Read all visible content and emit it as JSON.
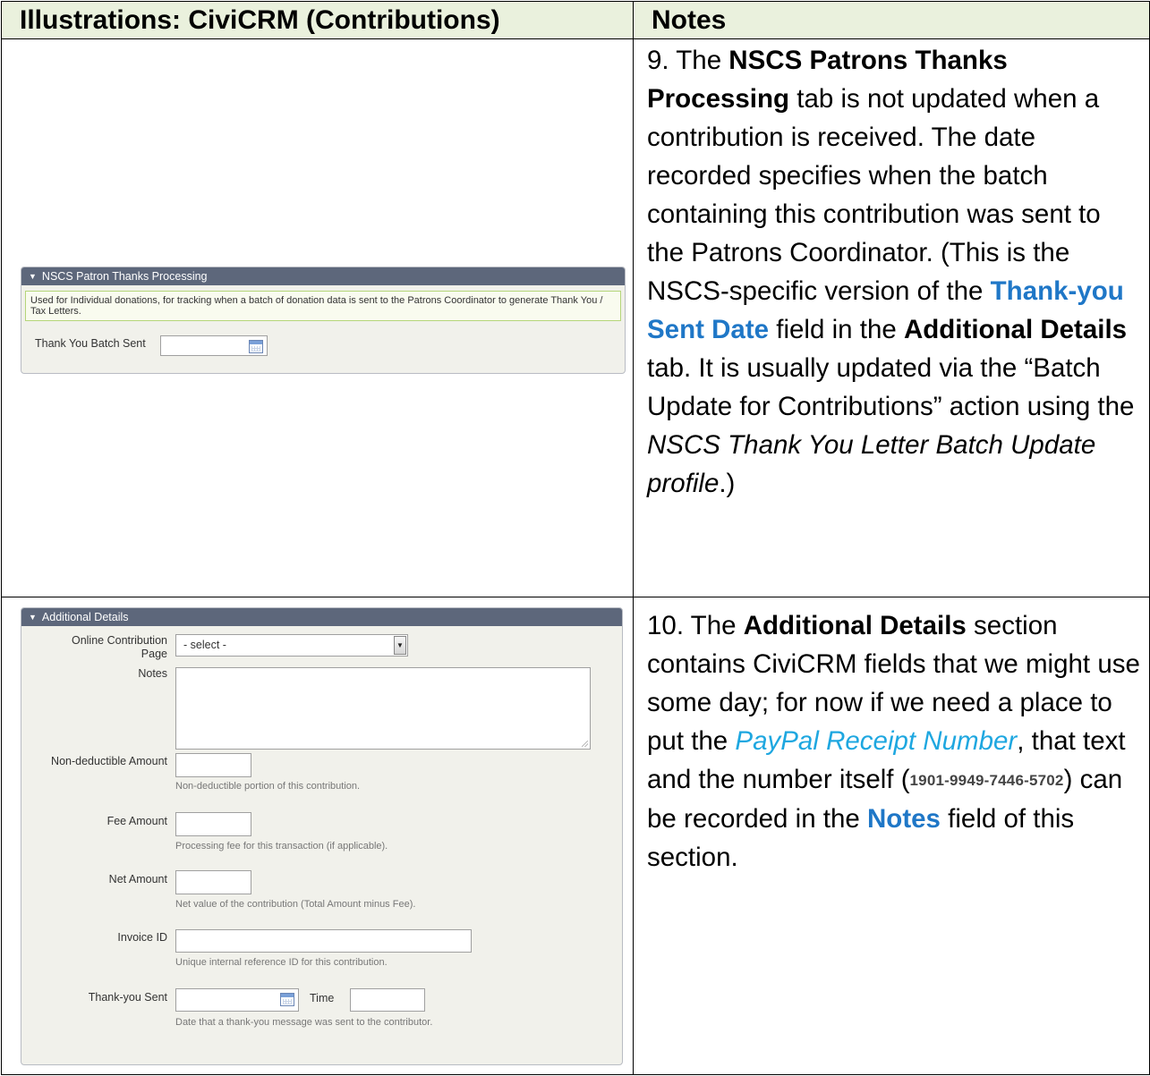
{
  "table": {
    "header_left": "Illustrations:  CiviCRM (Contributions)",
    "header_right": "Notes"
  },
  "panel1": {
    "title": "NSCS Patron Thanks Processing",
    "help_text": "Used for Individual donations, for tracking when a batch of donation data is sent to the Patrons Coordinator to generate Thank You / Tax Letters.",
    "field_label": "Thank You Batch Sent",
    "field_value": ""
  },
  "panel2": {
    "title": "Additional Details",
    "online_page_label_1": "Online Contribution",
    "online_page_label_2": "Page",
    "online_page_value": "- select -",
    "notes_label": "Notes",
    "notes_value": "",
    "nondeductible_label": "Non-deductible Amount",
    "nondeductible_help": "Non-deductible portion of this contribution.",
    "fee_label": "Fee Amount",
    "fee_help": "Processing fee for this transaction (if applicable).",
    "net_label": "Net Amount",
    "net_help": "Net value of the contribution (Total Amount minus Fee).",
    "invoice_label": "Invoice ID",
    "invoice_help": "Unique internal reference ID for this contribution.",
    "thankyou_label": "Thank-you Sent",
    "time_label": "Time",
    "thankyou_help": "Date that a thank-you message was sent to the contributor."
  },
  "note9": {
    "t1": "9. The ",
    "t2": "NSCS Patrons Thanks Processing",
    "t3": " tab is not updated when a contribution is received.  The date recorded specifies when the batch containing this contribution was sent to the Patrons Coordinator.  (This is the NSCS-specific version of the ",
    "t4": "Thank-you Sent Date",
    "t5": " field in the ",
    "t6": "Additional Details",
    "t7": " tab.  It is usually updated via the “Batch Update for Contributions” action using the ",
    "t8": "NSCS Thank You Letter Batch Update profile",
    "t9": ".)"
  },
  "note10": {
    "t1": "10. The ",
    "t2": "Additional Details",
    "t3": " section contains CiviCRM fields that we might use some day; for now if we need a place to put the ",
    "t4": "PayPal Receipt Number",
    "t5": ", that text and the number itself (",
    "t6": "1901-9949-7446-5702",
    "t7": ") can be recorded in the ",
    "t8": "Notes",
    "t9": " field of this section."
  }
}
